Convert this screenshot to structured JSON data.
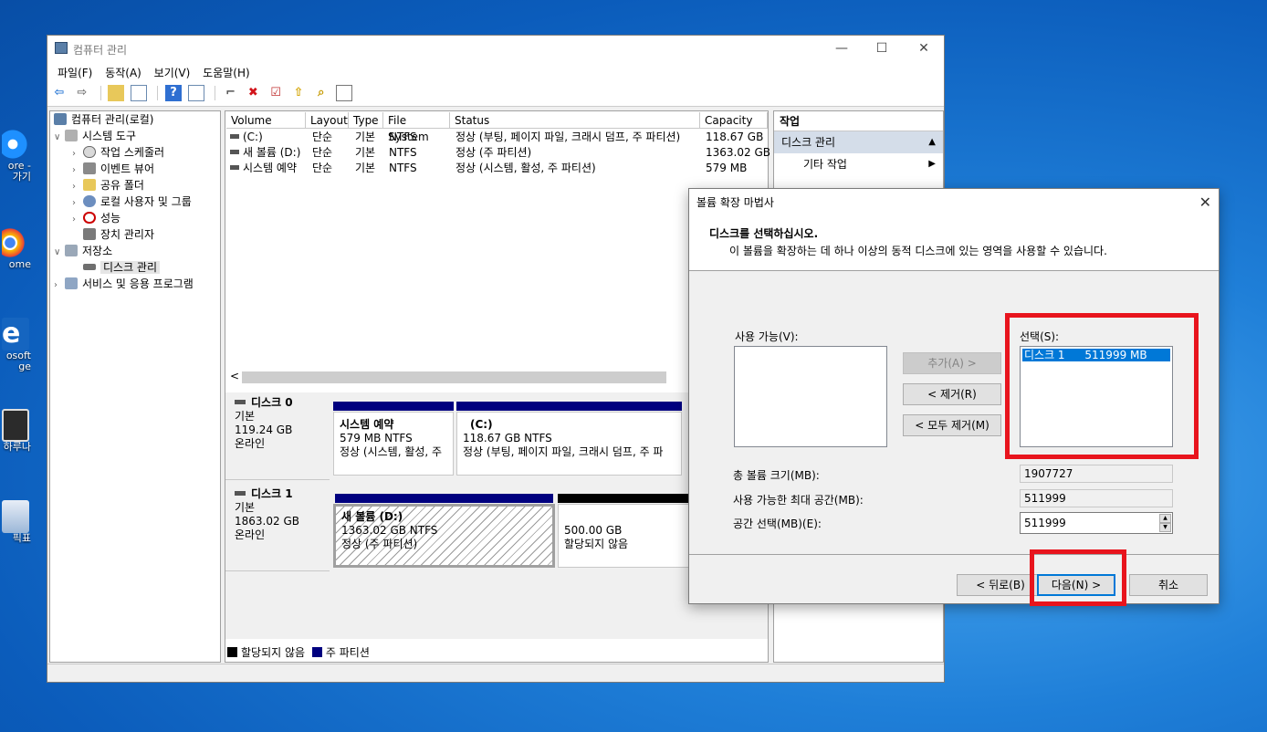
{
  "desktop": {
    "icons": [
      {
        "label": "ore -",
        "label2": "가기",
        "icon": "edge-legacy-icon"
      },
      {
        "label": "ome",
        "icon": "chrome-icon"
      },
      {
        "label": "osoft",
        "label2": "ge",
        "icon": "edge-icon"
      },
      {
        "label": "하루나",
        "icon": "app-icon"
      },
      {
        "label": "픽표",
        "icon": "shortcut-icon"
      }
    ]
  },
  "window": {
    "title": "컴퓨터 관리",
    "controls": {
      "minimize": "—",
      "maximize": "☐",
      "close": "✕"
    },
    "menu": [
      "파일(F)",
      "동작(A)",
      "보기(V)",
      "도움말(H)"
    ]
  },
  "tree": {
    "root": "컴퓨터 관리(로컬)",
    "system_tools": "시스템 도구",
    "task_scheduler": "작업 스케줄러",
    "event_viewer": "이벤트 뷰어",
    "shared_folders": "공유 폴더",
    "local_users": "로컬 사용자 및 그룹",
    "performance": "성능",
    "device_manager": "장치 관리자",
    "storage": "저장소",
    "disk_management": "디스크 관리",
    "services": "서비스 및 응용 프로그램"
  },
  "volumes": {
    "columns": [
      "Volume",
      "Layout",
      "Type",
      "File System",
      "Status",
      "Capacity"
    ],
    "rows": [
      [
        "(C:)",
        "단순",
        "기본",
        "NTFS",
        "정상 (부팅, 페이지 파일, 크래시 덤프, 주 파티션)",
        "118.67 GB"
      ],
      [
        "새 볼륨 (D:)",
        "단순",
        "기본",
        "NTFS",
        "정상 (주 파티션)",
        "1363.02 GB"
      ],
      [
        "시스템 예약",
        "단순",
        "기본",
        "NTFS",
        "정상 (시스템, 활성, 주 파티션)",
        "579 MB"
      ]
    ],
    "scroll_left": "<"
  },
  "disks": {
    "disk0": {
      "name": "디스크 0",
      "type": "기본",
      "size": "119.24 GB",
      "state": "온라인",
      "p1": {
        "name": "시스템 예약",
        "size": "579 MB NTFS",
        "status": "정상 (시스템, 활성, 주"
      },
      "p2": {
        "name": "(C:)",
        "size": "118.67 GB NTFS",
        "status": "정상 (부팅, 페이지 파일, 크래시 덤프, 주 파"
      }
    },
    "disk1": {
      "name": "디스크 1",
      "type": "기본",
      "size": "1863.02 GB",
      "state": "온라인",
      "p1": {
        "name": "새 볼륨  (D:)",
        "size": "1363.02 GB NTFS",
        "status": "정상 (주 파티션)"
      },
      "p2": {
        "size": "500.00 GB",
        "status": "할당되지 않음"
      }
    },
    "legend": {
      "unallocated": "할당되지 않음",
      "primary": "주 파티션"
    }
  },
  "actions": {
    "header": "작업",
    "section": "디스크 관리",
    "more": "기타 작업"
  },
  "wizard": {
    "title": "볼륨 확장 마법사",
    "heading": "디스크를 선택하십시오.",
    "subheading": "이 볼륨을 확장하는 데 하나 이상의 동적 디스크에 있는 영역을 사용할 수 있습니다.",
    "available_label": "사용 가능(V):",
    "selected_label": "선택(S):",
    "selected_items": [
      {
        "disk": "디스크 1",
        "size": "511999 MB"
      }
    ],
    "add_btn": "추가(A) >",
    "remove_btn": "< 제거(R)",
    "remove_all_btn": "< 모두 제거(M)",
    "total_label": "총 볼륨 크기(MB):",
    "total_value": "1907727",
    "max_label": "사용 가능한 최대 공간(MB):",
    "max_value": "511999",
    "select_label": "공간 선택(MB)(E):",
    "select_value": "511999",
    "back_btn": "< 뒤로(B)",
    "next_btn": "다음(N) >",
    "cancel_btn": "취소"
  },
  "colors": {
    "primary_partition": "#00007f",
    "unallocated": "#000000",
    "highlight": "#e8141d",
    "selection": "#0078d7"
  }
}
